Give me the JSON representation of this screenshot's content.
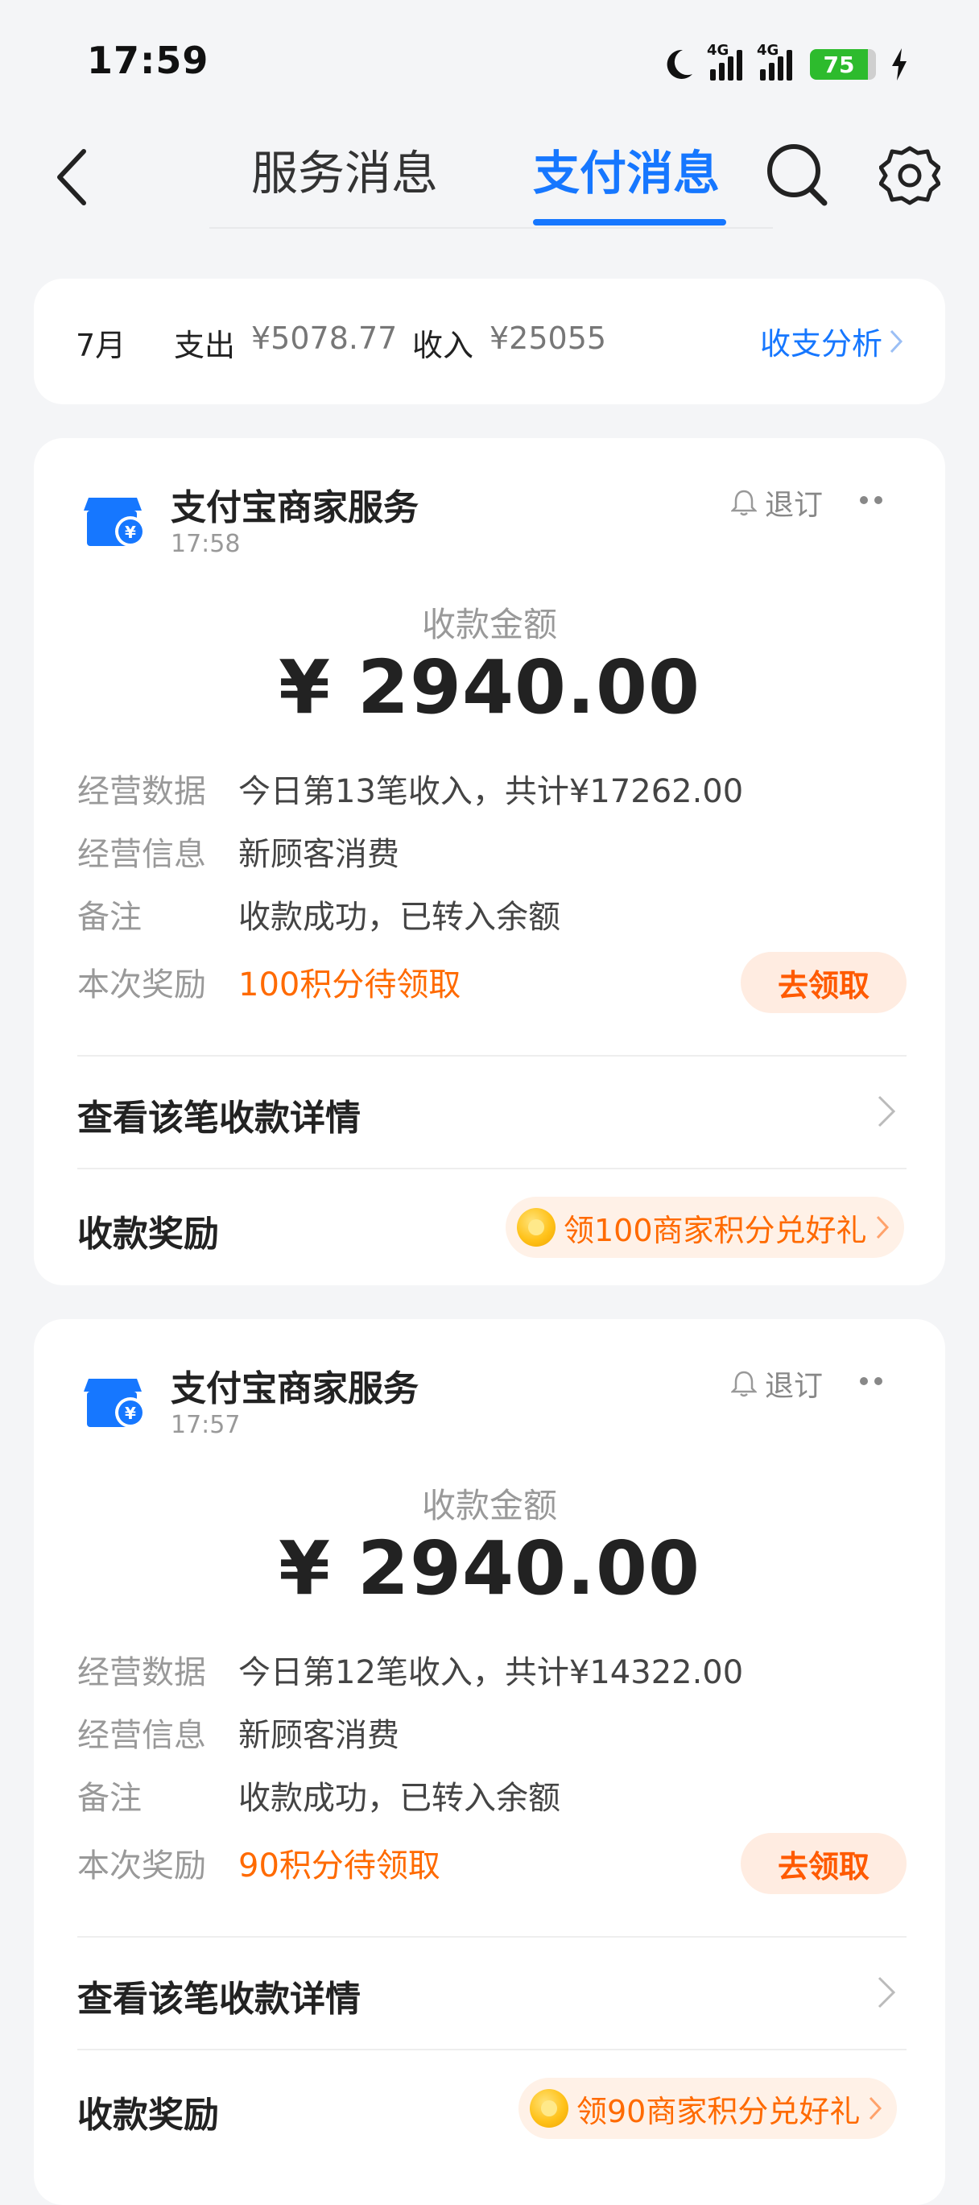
{
  "status_bar": {
    "time": "17:59",
    "network_1": "4G",
    "network_2": "4G",
    "battery": "75"
  },
  "header": {
    "tabs": [
      {
        "label": "服务消息",
        "active": false
      },
      {
        "label": "支付消息",
        "active": true
      }
    ]
  },
  "summary": {
    "month": "7月",
    "expense_label": "支出",
    "expense_value": "¥5078.77",
    "income_label": "收入",
    "income_value": "¥25055",
    "analysis_link": "收支分析"
  },
  "cards": [
    {
      "sender": "支付宝商家服务",
      "time": "17:58",
      "unsubscribe": "退订",
      "amount_label": "收款金额",
      "amount": "¥ 2940.00",
      "rows": [
        {
          "key": "经营数据",
          "value": "今日第13笔收入，共计¥17262.00"
        },
        {
          "key": "经营信息",
          "value": "新顾客消费"
        },
        {
          "key": "备注",
          "value": "收款成功，已转入余额"
        },
        {
          "key": "本次奖励",
          "value": "100积分待领取"
        }
      ],
      "claim_button": "去领取",
      "details_link": "查看该笔收款详情",
      "reward_label": "收款奖励",
      "reward_pill": "领100商家积分兑好礼"
    },
    {
      "sender": "支付宝商家服务",
      "time": "17:57",
      "unsubscribe": "退订",
      "amount_label": "收款金额",
      "amount": "¥ 2940.00",
      "rows": [
        {
          "key": "经营数据",
          "value": "今日第12笔收入，共计¥14322.00"
        },
        {
          "key": "经营信息",
          "value": "新顾客消费"
        },
        {
          "key": "备注",
          "value": "收款成功，已转入余额"
        },
        {
          "key": "本次奖励",
          "value": "90积分待领取"
        }
      ],
      "claim_button": "去领取",
      "details_link": "查看该笔收款详情",
      "reward_label": "收款奖励",
      "reward_pill": "领90商家积分兑好礼"
    }
  ],
  "colors": {
    "accent": "#1677ff",
    "orange": "#ff6a00",
    "background": "#f4f5f7"
  }
}
